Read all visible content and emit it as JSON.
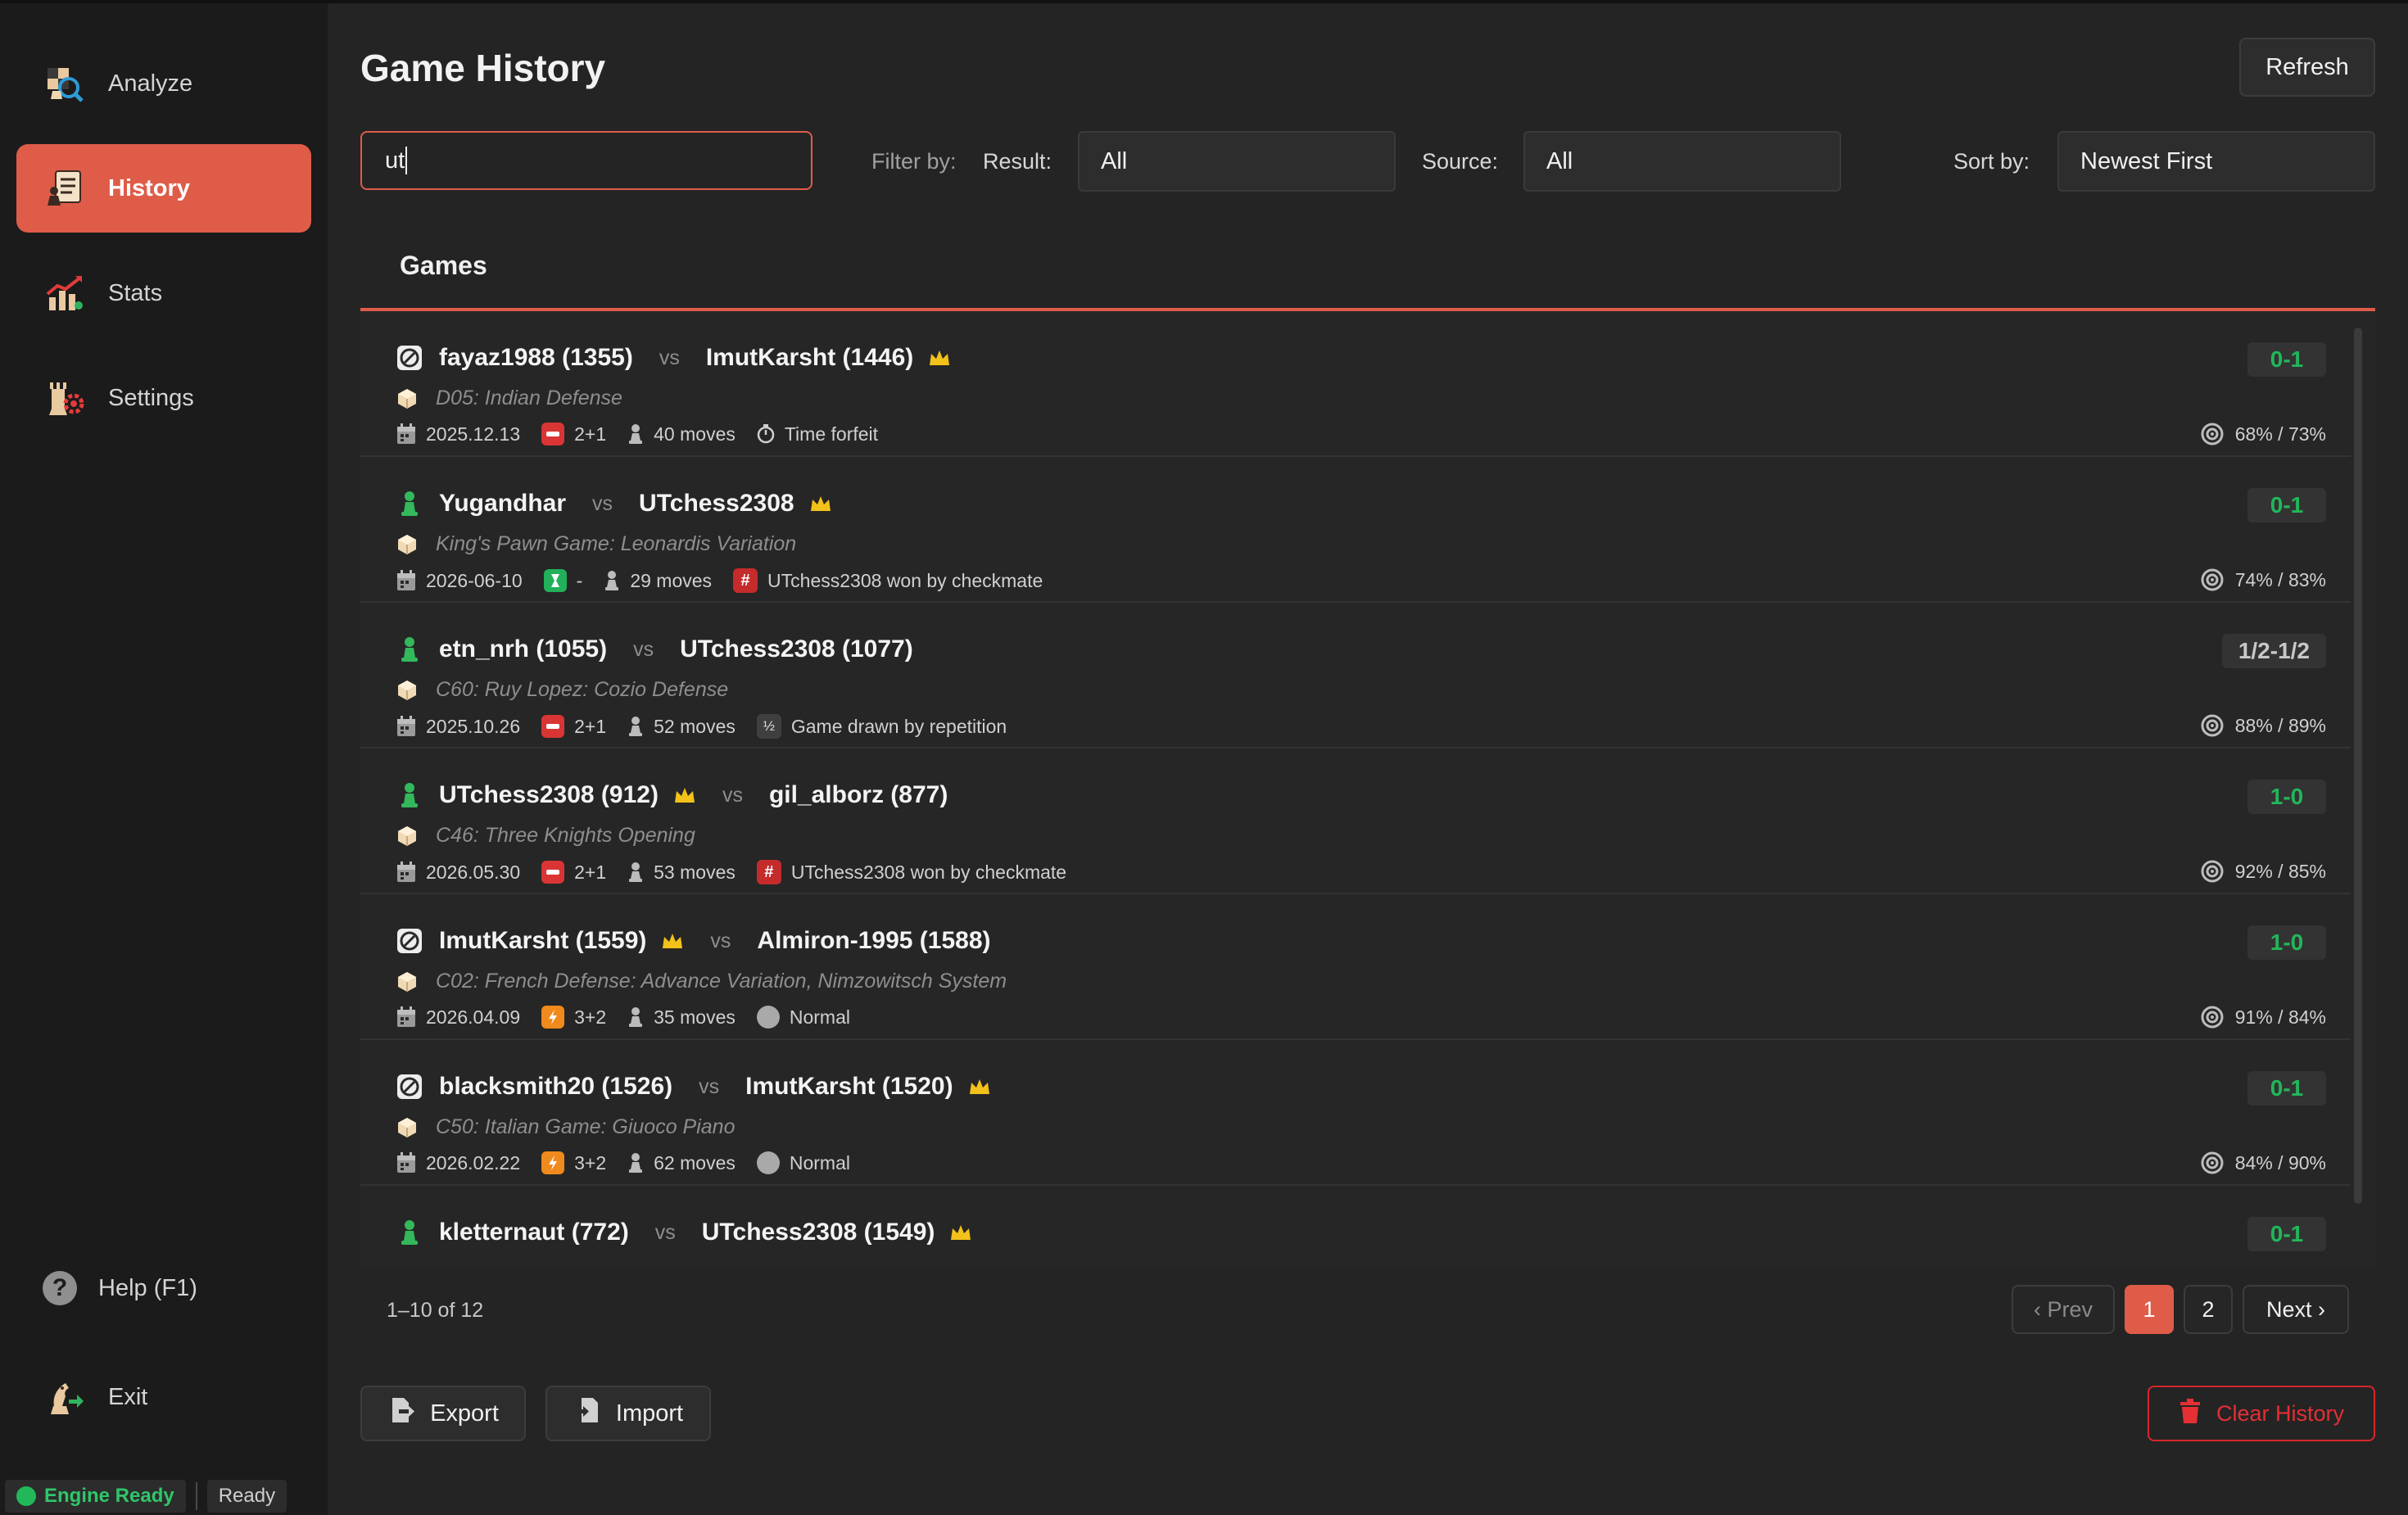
{
  "sidebar": {
    "items": [
      {
        "label": "Analyze",
        "icon": "analyze-icon"
      },
      {
        "label": "History",
        "icon": "history-icon",
        "active": true
      },
      {
        "label": "Stats",
        "icon": "stats-icon"
      },
      {
        "label": "Settings",
        "icon": "settings-icon"
      }
    ],
    "help_label": "Help (F1)",
    "exit_label": "Exit"
  },
  "status": {
    "engine": "Engine Ready",
    "state": "Ready"
  },
  "header": {
    "title": "Game History",
    "refresh_label": "Refresh"
  },
  "filters": {
    "search_value": "ut",
    "filter_by_label": "Filter by:",
    "result_label": "Result:",
    "result_value": "All",
    "source_label": "Source:",
    "source_value": "All",
    "sort_label": "Sort by:",
    "sort_value": "Newest First"
  },
  "games_tab_label": "Games",
  "vs_label": "vs",
  "games": [
    {
      "source": "chesscom",
      "white": "fayaz1988 (1355)",
      "black": "ImutKarsht (1446)",
      "crown": "black",
      "opening": "D05: Indian Defense",
      "date": "2025.12.13",
      "tc_type": "bullet",
      "tc": "2+1",
      "moves": "40 moves",
      "term_type": "clock",
      "termination": "Time forfeit",
      "accuracy": "68% / 73%",
      "result": "0-1"
    },
    {
      "source": "pawn",
      "white": "Yugandhar",
      "black": "UTchess2308",
      "crown": "black",
      "opening": "King's Pawn Game: Leonardis Variation",
      "date": "2026-06-10",
      "tc_type": "daily",
      "tc": "-",
      "moves": "29 moves",
      "term_type": "hash",
      "termination": "UTchess2308 won by checkmate",
      "accuracy": "74% / 83%",
      "result": "0-1"
    },
    {
      "source": "pawn",
      "white": "etn_nrh (1055)",
      "black": "UTchess2308 (1077)",
      "crown": "none",
      "opening": "C60: Ruy Lopez: Cozio Defense",
      "date": "2025.10.26",
      "tc_type": "bullet",
      "tc": "2+1",
      "moves": "52 moves",
      "term_type": "draw",
      "termination": "Game drawn by repetition",
      "accuracy": "88% / 89%",
      "result": "1/2-1/2"
    },
    {
      "source": "pawn",
      "white": "UTchess2308 (912)",
      "black": "gil_alborz (877)",
      "crown": "white",
      "opening": "C46: Three Knights Opening",
      "date": "2026.05.30",
      "tc_type": "bullet",
      "tc": "2+1",
      "moves": "53 moves",
      "term_type": "hash",
      "termination": "UTchess2308 won by checkmate",
      "accuracy": "92% / 85%",
      "result": "1-0"
    },
    {
      "source": "chesscom",
      "white": "ImutKarsht (1559)",
      "black": "Almiron-1995 (1588)",
      "crown": "white",
      "opening": "C02: French Defense: Advance Variation, Nimzowitsch System",
      "date": "2026.04.09",
      "tc_type": "blitz",
      "tc": "3+2",
      "moves": "35 moves",
      "term_type": "normal",
      "termination": "Normal",
      "accuracy": "91% / 84%",
      "result": "1-0"
    },
    {
      "source": "chesscom",
      "white": "blacksmith20 (1526)",
      "black": "ImutKarsht (1520)",
      "crown": "black",
      "opening": "C50: Italian Game: Giuoco Piano",
      "date": "2026.02.22",
      "tc_type": "blitz",
      "tc": "3+2",
      "moves": "62 moves",
      "term_type": "normal",
      "termination": "Normal",
      "accuracy": "84% / 90%",
      "result": "0-1"
    },
    {
      "source": "pawn",
      "white": "kletternaut (772)",
      "black": "UTchess2308 (1549)",
      "crown": "black",
      "opening": "",
      "date": "",
      "tc_type": "",
      "tc": "",
      "moves": "",
      "term_type": "",
      "termination": "",
      "accuracy": "",
      "result": "0-1"
    }
  ],
  "pagination": {
    "info": "1–10 of 12",
    "prev": "‹ Prev",
    "pages": [
      "1",
      "2"
    ],
    "next": "Next ›"
  },
  "footer": {
    "export_label": "Export",
    "import_label": "Import",
    "clear_label": "Clear History"
  },
  "colors": {
    "accent": "#df5c49",
    "win": "#22b65a",
    "danger": "#e42f34",
    "crown": "#f2c21b"
  }
}
